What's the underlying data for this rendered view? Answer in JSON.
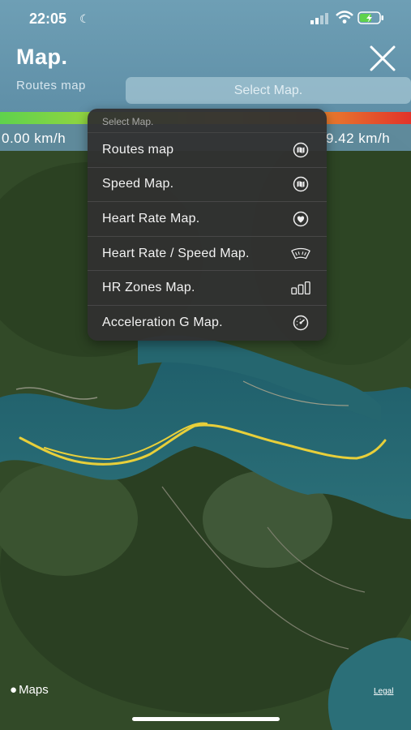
{
  "status_bar": {
    "time": "22:05"
  },
  "header": {
    "title": "Map.",
    "routes_label": "Routes map",
    "select_placeholder": "Select Map."
  },
  "speed_scale": {
    "min_label": "0.00 km/h",
    "max_label": "9.42 km/h"
  },
  "menu": {
    "header": "Select Map.",
    "items": [
      {
        "label": "Routes map",
        "icon": "map-icon"
      },
      {
        "label": "Speed Map.",
        "icon": "map-icon"
      },
      {
        "label": "Heart Rate Map.",
        "icon": "heart-icon"
      },
      {
        "label": "Heart Rate / Speed Map.",
        "icon": "gauge-arc-icon"
      },
      {
        "label": "HR Zones Map.",
        "icon": "bars-icon"
      },
      {
        "label": "Acceleration G Map.",
        "icon": "speedometer-icon"
      }
    ]
  },
  "footer": {
    "maps_brand": "Maps",
    "legal": "Legal"
  },
  "colors": {
    "route": "#e8cf3a",
    "menu_bg": "#303030",
    "header_bg": "#6e9fb5"
  }
}
